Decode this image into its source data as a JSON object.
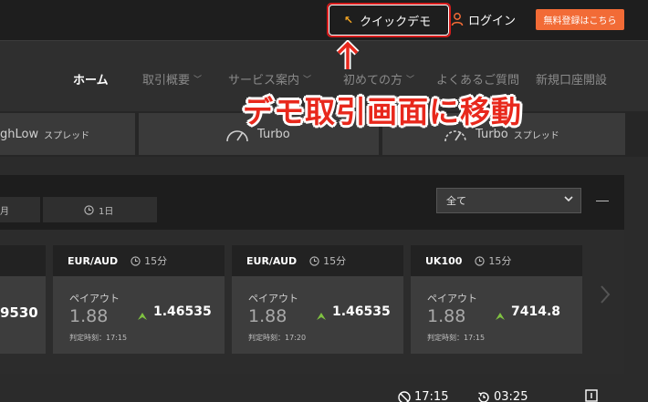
{
  "header": {
    "quick_demo_label": "クイックデモ",
    "login_label": "ログイン",
    "register_label": "無料登録はこちら"
  },
  "nav": {
    "items": [
      {
        "label": "ホーム",
        "active": true
      },
      {
        "label": "取引概要",
        "has_menu": true
      },
      {
        "label": "サービス案内",
        "has_menu": true
      },
      {
        "label": "初めての方",
        "has_menu": true
      },
      {
        "label": "よくあるご質問"
      },
      {
        "label": "新規口座開設"
      }
    ]
  },
  "callout": {
    "text": "デモ取引画面に移動",
    "color": "#e8281c"
  },
  "trade_types": [
    {
      "label": "ghLow",
      "sub": "スプレッド"
    },
    {
      "label": "Turbo",
      "sub": ""
    },
    {
      "label": "Turbo",
      "sub": "スプレッド"
    }
  ],
  "periods": [
    {
      "label": "月"
    },
    {
      "label": "1日"
    }
  ],
  "filter": {
    "selected": "全て"
  },
  "partial_price": "9530",
  "cards": [
    {
      "symbol": "EUR/AUD",
      "duration": "15分",
      "payout_label": "ペイアウト",
      "payout": "1.88",
      "price": "1.46535",
      "time": "判定時刻：17:15"
    },
    {
      "symbol": "EUR/AUD",
      "duration": "15分",
      "payout_label": "ペイアウト",
      "payout": "1.88",
      "price": "1.46535",
      "time": "判定時刻：17:20"
    },
    {
      "symbol": "UK100",
      "duration": "15分",
      "payout_label": "ペイアウト",
      "payout": "1.88",
      "price": "7414.8",
      "time": "判定時刻：17:15"
    }
  ],
  "bottom": {
    "close_time": "17:15",
    "remaining": "03:25"
  },
  "colors": {
    "accent": "#f26b36",
    "highlight": "#d51a1a",
    "up": "#7fc241",
    "icon_orange": "#f5a623"
  }
}
